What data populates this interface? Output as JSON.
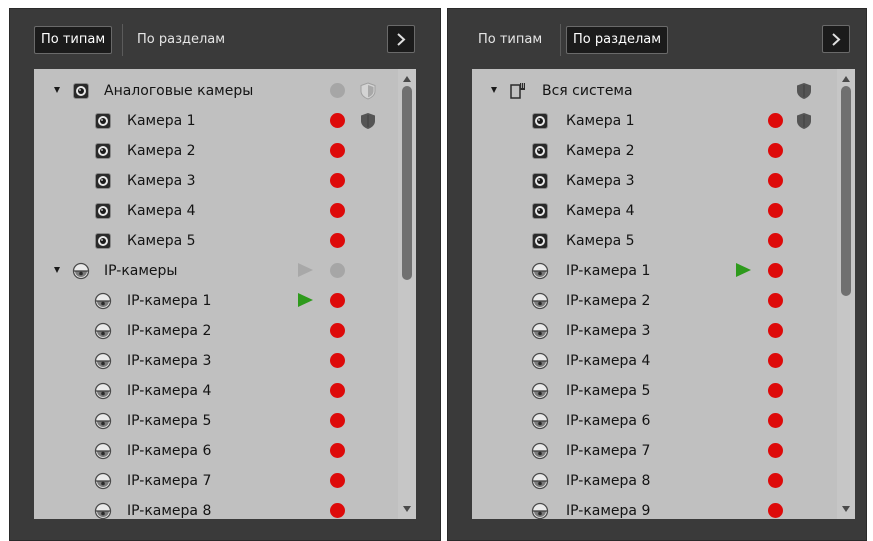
{
  "left_panel": {
    "tabs": [
      "По типам",
      "По разделам"
    ],
    "active_tab": 0,
    "nav_icon": "chevron-right-icon",
    "rows": [
      {
        "label": "Аналоговые камеры",
        "level": 0,
        "expanded": true,
        "icon": "analog-camera-icon",
        "status": "gray",
        "play": null,
        "shield": "outline"
      },
      {
        "label": "Камера 1",
        "level": 1,
        "icon": "analog-camera-icon",
        "status": "red",
        "play": null,
        "shield": "filled"
      },
      {
        "label": "Камера 2",
        "level": 1,
        "icon": "analog-camera-icon",
        "status": "red",
        "play": null,
        "shield": null
      },
      {
        "label": "Камера 3",
        "level": 1,
        "icon": "analog-camera-icon",
        "status": "red",
        "play": null,
        "shield": null
      },
      {
        "label": "Камера 4",
        "level": 1,
        "icon": "analog-camera-icon",
        "status": "red",
        "play": null,
        "shield": null
      },
      {
        "label": "Камера 5",
        "level": 1,
        "icon": "analog-camera-icon",
        "status": "red",
        "play": null,
        "shield": null
      },
      {
        "label": "IP-камеры",
        "level": 0,
        "expanded": true,
        "icon": "ip-camera-icon",
        "status": "gray",
        "play": "gray",
        "shield": null
      },
      {
        "label": "IP-камера 1",
        "level": 1,
        "icon": "ip-camera-icon",
        "status": "red",
        "play": "green",
        "shield": null
      },
      {
        "label": "IP-камера 2",
        "level": 1,
        "icon": "ip-camera-icon",
        "status": "red",
        "play": null,
        "shield": null
      },
      {
        "label": "IP-камера 3",
        "level": 1,
        "icon": "ip-camera-icon",
        "status": "red",
        "play": null,
        "shield": null
      },
      {
        "label": "IP-камера 4",
        "level": 1,
        "icon": "ip-camera-icon",
        "status": "red",
        "play": null,
        "shield": null
      },
      {
        "label": "IP-камера 5",
        "level": 1,
        "icon": "ip-camera-icon",
        "status": "red",
        "play": null,
        "shield": null
      },
      {
        "label": "IP-камера 6",
        "level": 1,
        "icon": "ip-camera-icon",
        "status": "red",
        "play": null,
        "shield": null
      },
      {
        "label": "IP-камера 7",
        "level": 1,
        "icon": "ip-camera-icon",
        "status": "red",
        "play": null,
        "shield": null
      },
      {
        "label": "IP-камера 8",
        "level": 1,
        "icon": "ip-camera-icon",
        "status": "red",
        "play": null,
        "shield": null
      }
    ]
  },
  "right_panel": {
    "tabs": [
      "По типам",
      "По разделам"
    ],
    "active_tab": 1,
    "nav_icon": "chevron-right-icon",
    "rows": [
      {
        "label": "Вся система",
        "level": 0,
        "expanded": true,
        "icon": "system-icon",
        "status": null,
        "play": null,
        "shield": "filled"
      },
      {
        "label": "Камера 1",
        "level": 1,
        "icon": "analog-camera-icon",
        "status": "red",
        "play": null,
        "shield": "filled"
      },
      {
        "label": "Камера 2",
        "level": 1,
        "icon": "analog-camera-icon",
        "status": "red",
        "play": null,
        "shield": null
      },
      {
        "label": "Камера 3",
        "level": 1,
        "icon": "analog-camera-icon",
        "status": "red",
        "play": null,
        "shield": null
      },
      {
        "label": "Камера 4",
        "level": 1,
        "icon": "analog-camera-icon",
        "status": "red",
        "play": null,
        "shield": null
      },
      {
        "label": "Камера 5",
        "level": 1,
        "icon": "analog-camera-icon",
        "status": "red",
        "play": null,
        "shield": null
      },
      {
        "label": "IP-камера 1",
        "level": 1,
        "icon": "ip-camera-icon",
        "status": "red",
        "play": "green",
        "shield": null
      },
      {
        "label": "IP-камера 2",
        "level": 1,
        "icon": "ip-camera-icon",
        "status": "red",
        "play": null,
        "shield": null
      },
      {
        "label": "IP-камера 3",
        "level": 1,
        "icon": "ip-camera-icon",
        "status": "red",
        "play": null,
        "shield": null
      },
      {
        "label": "IP-камера 4",
        "level": 1,
        "icon": "ip-camera-icon",
        "status": "red",
        "play": null,
        "shield": null
      },
      {
        "label": "IP-камера 5",
        "level": 1,
        "icon": "ip-camera-icon",
        "status": "red",
        "play": null,
        "shield": null
      },
      {
        "label": "IP-камера 6",
        "level": 1,
        "icon": "ip-camera-icon",
        "status": "red",
        "play": null,
        "shield": null
      },
      {
        "label": "IP-камера 7",
        "level": 1,
        "icon": "ip-camera-icon",
        "status": "red",
        "play": null,
        "shield": null
      },
      {
        "label": "IP-камера 8",
        "level": 1,
        "icon": "ip-camera-icon",
        "status": "red",
        "play": null,
        "shield": null
      },
      {
        "label": "IP-камера 9",
        "level": 1,
        "icon": "ip-camera-icon",
        "status": "red",
        "play": null,
        "shield": null
      }
    ]
  },
  "colors": {
    "panel_bg": "#3a3a3a",
    "tree_bg": "#c0c0c0",
    "status_red": "#dd0a0a",
    "status_gray": "#a6a6a6",
    "play_green": "#2e9a1c",
    "active_tab_bg": "#1b1b1b"
  }
}
